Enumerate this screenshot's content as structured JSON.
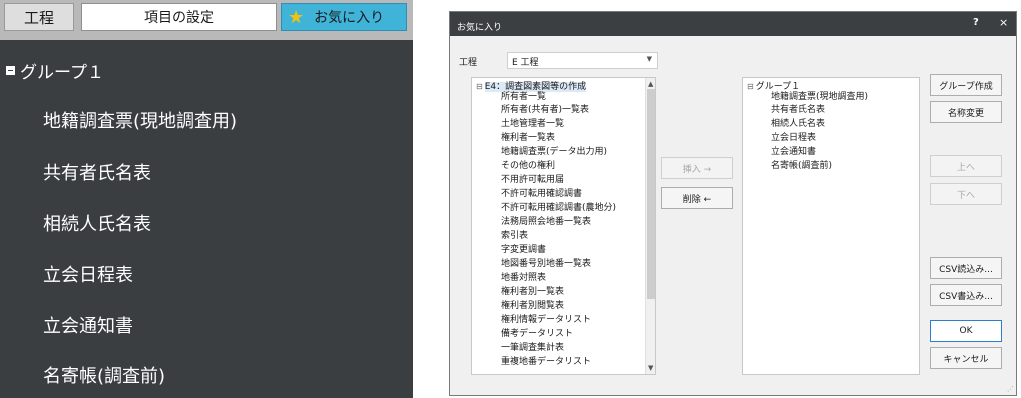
{
  "left_panel": {
    "tabs": {
      "kotei": "工程",
      "settings": "項目の設定",
      "favorites": "お気に入り"
    },
    "favorites_icon": "star-icon",
    "group_label": "グループ１",
    "items": [
      "地籍調査票(現地調査用)",
      "共有者氏名表",
      "相続人氏名表",
      "立会日程表",
      "立会通知書",
      "名寄帳(調査前)"
    ]
  },
  "dialog": {
    "title": "お気に入り",
    "help": "?",
    "close": "×",
    "kotei_label": "工程",
    "kotei_value": "E 工程",
    "source_root": "E4：調査図素図等の作成",
    "source_items": [
      "所有者一覧",
      "所有者(共有者)一覧表",
      "土地管理者一覧",
      "権利者一覧表",
      "地籍調査票(データ出力用)",
      "その他の権利",
      "不用許可転用届",
      "不許可転用確認調書",
      "不許可転用確認調書(農地分)",
      "法務局照会地番一覧表",
      "索引表",
      "字変更調書",
      "地図番号別地番一覧表",
      "地番対照表",
      "権利者別一覧表",
      "権利者別閲覧表",
      "権利情報データリスト",
      "備考データリスト",
      "一筆調査集計表",
      "重複地番データリスト"
    ],
    "insert_button": "挿入 →",
    "delete_button": "削除 ←",
    "target_root": "グループ１",
    "target_items": [
      "地籍調査票(現地調査用)",
      "共有者氏名表",
      "相続人氏名表",
      "立会日程表",
      "立会通知書",
      "名寄帳(調査前)"
    ],
    "buttons": {
      "group_create": "グループ作成",
      "rename": "名称変更",
      "up": "上へ",
      "down": "下へ",
      "csv_import": "CSV読込み...",
      "csv_export": "CSV書込み...",
      "ok": "OK",
      "cancel": "キャンセル"
    }
  }
}
